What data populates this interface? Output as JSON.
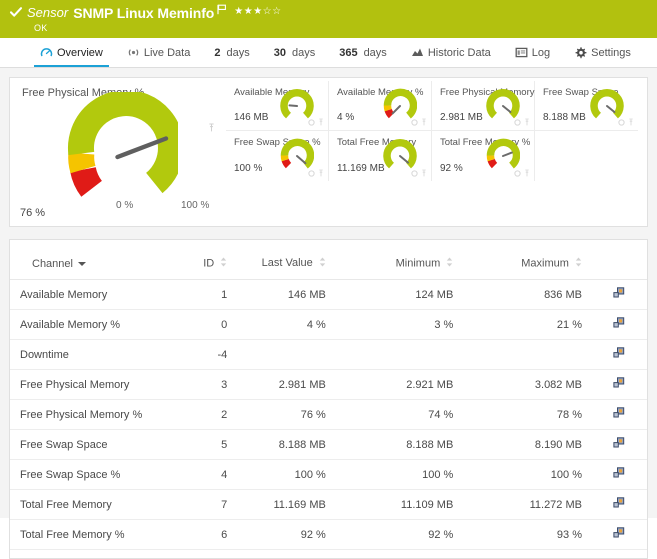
{
  "header": {
    "status_icon": "check-icon",
    "kind_label": "Sensor",
    "title": "SNMP Linux Meminfo",
    "flag_icon": "flag-icon",
    "stars": "★★★☆☆",
    "rating_value": 3,
    "rating_max": 5,
    "status_text": "OK",
    "bg_color": "#b2c10f"
  },
  "tabs": [
    {
      "label": "Overview",
      "icon": "gauge-icon",
      "active": true
    },
    {
      "label": "Live Data",
      "icon": "live-signal-icon",
      "active": false
    },
    {
      "num": "2",
      "label": "days",
      "icon": "",
      "active": false
    },
    {
      "num": "30",
      "label": "days",
      "icon": "",
      "active": false
    },
    {
      "num": "365",
      "label": "days",
      "icon": "",
      "active": false
    },
    {
      "label": "Historic Data",
      "icon": "chart-icon",
      "active": false
    },
    {
      "label": "Log",
      "icon": "log-icon",
      "active": false
    },
    {
      "label": "Settings",
      "icon": "gear-icon",
      "active": false
    }
  ],
  "main_gauge": {
    "title": "Free Physical Memory %",
    "value_text": "76 %",
    "value": 76,
    "scale_min_label": "0 %",
    "scale_max_label": "100 %",
    "colors": {
      "red": "#e01b17",
      "yellow": "#f5c400",
      "green": "#b2c90d",
      "needle": "#5f5f5f"
    }
  },
  "mini_gauges": [
    {
      "title": "Available Memory",
      "value_text": "146 MB",
      "percent": 17
    },
    {
      "title": "Available Memory %",
      "value_text": "4 %",
      "percent": 4
    },
    {
      "title": "Free Physical Memory",
      "value_text": "2.981 MB",
      "percent": 75
    },
    {
      "title": "Free Swap Space",
      "value_text": "8.188 MB",
      "percent": 72
    },
    {
      "title": "Free Swap Space %",
      "value_text": "100 %",
      "percent": 100
    },
    {
      "title": "Total Free Memory",
      "value_text": "11.169 MB",
      "percent": 80
    },
    {
      "title": "Total Free Memory %",
      "value_text": "92 %",
      "percent": 92
    }
  ],
  "channel_table": {
    "columns": [
      {
        "key": "channel",
        "label": "Channel",
        "sortable": true,
        "sorted": true
      },
      {
        "key": "id",
        "label": "ID",
        "sortable": true
      },
      {
        "key": "last",
        "label": "Last Value",
        "sortable": true
      },
      {
        "key": "min",
        "label": "Minimum",
        "sortable": true
      },
      {
        "key": "max",
        "label": "Maximum",
        "sortable": true
      },
      {
        "key": "actions",
        "label": "",
        "sortable": false
      }
    ],
    "rows": [
      {
        "channel": "Available Memory",
        "id": "1",
        "last": "146 MB",
        "min": "124 MB",
        "max": "836 MB"
      },
      {
        "channel": "Available Memory %",
        "id": "0",
        "last": "4 %",
        "min": "3 %",
        "max": "21 %"
      },
      {
        "channel": "Downtime",
        "id": "-4",
        "last": "",
        "min": "",
        "max": ""
      },
      {
        "channel": "Free Physical Memory",
        "id": "3",
        "last": "2.981 MB",
        "min": "2.921 MB",
        "max": "3.082 MB"
      },
      {
        "channel": "Free Physical Memory %",
        "id": "2",
        "last": "76 %",
        "min": "74 %",
        "max": "78 %"
      },
      {
        "channel": "Free Swap Space",
        "id": "5",
        "last": "8.188 MB",
        "min": "8.188 MB",
        "max": "8.190 MB"
      },
      {
        "channel": "Free Swap Space %",
        "id": "4",
        "last": "100 %",
        "min": "100 %",
        "max": "100 %"
      },
      {
        "channel": "Total Free Memory",
        "id": "7",
        "last": "11.169 MB",
        "min": "11.109 MB",
        "max": "11.272 MB"
      },
      {
        "channel": "Total Free Memory %",
        "id": "6",
        "last": "92 %",
        "min": "92 %",
        "max": "93 %"
      }
    ],
    "row_action_icon": "channel-settings-icon"
  },
  "panel_icons": {
    "settings_icon": "gauge-settings-icon",
    "pin_icon": "pin-icon"
  }
}
